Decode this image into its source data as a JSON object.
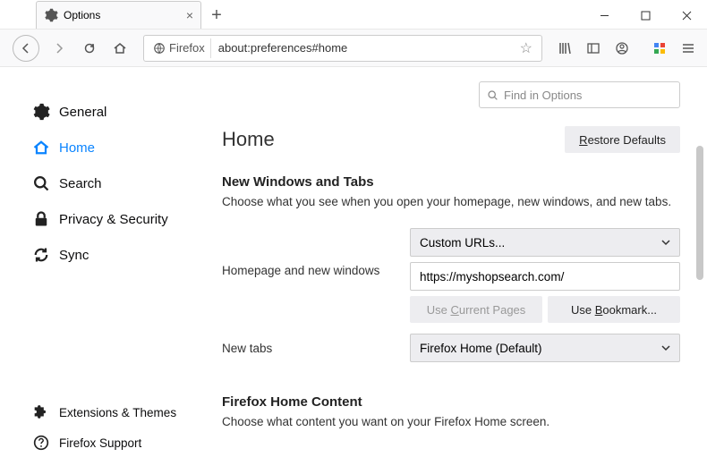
{
  "window": {
    "tab_title": "Options",
    "new_tab_tooltip": "+"
  },
  "toolbar": {
    "identity_label": "Firefox",
    "url": "about:preferences#home",
    "star_icon": "☆"
  },
  "search": {
    "placeholder": "Find in Options"
  },
  "sidebar": {
    "items": [
      {
        "label": "General"
      },
      {
        "label": "Home"
      },
      {
        "label": "Search"
      },
      {
        "label": "Privacy & Security"
      },
      {
        "label": "Sync"
      }
    ],
    "bottom": [
      {
        "label": "Extensions & Themes"
      },
      {
        "label": "Firefox Support"
      }
    ]
  },
  "main": {
    "heading": "Home",
    "restore_btn": "Restore Defaults",
    "section1": {
      "title": "New Windows and Tabs",
      "desc": "Choose what you see when you open your homepage, new windows, and new tabs."
    },
    "row1": {
      "label": "Homepage and new windows",
      "select_value": "Custom URLs...",
      "input_value": "https://myshopsearch.com/",
      "use_current": "Use Current Pages",
      "use_bookmark": "Use Bookmark..."
    },
    "row2": {
      "label": "New tabs",
      "select_value": "Firefox Home (Default)"
    },
    "section2": {
      "title": "Firefox Home Content",
      "desc": "Choose what content you want on your Firefox Home screen."
    }
  }
}
